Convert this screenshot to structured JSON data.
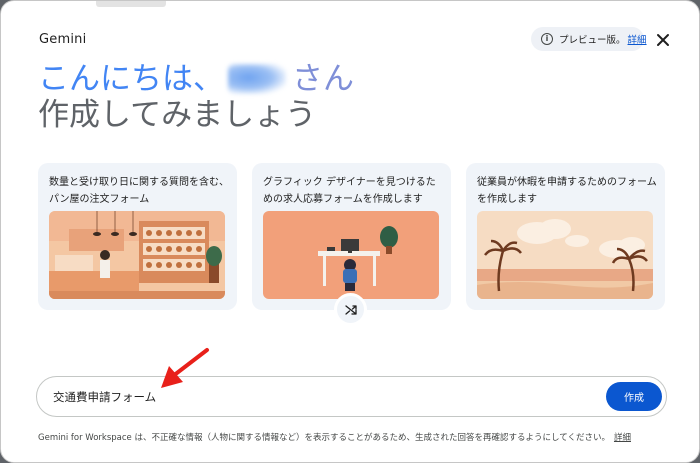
{
  "app": {
    "title": "Gemini"
  },
  "preview": {
    "text": "プレビュー版。",
    "link": "詳細"
  },
  "greeting": {
    "hello": "こんにちは、",
    "name_suffix": "さん",
    "subheading": "作成してみましょう"
  },
  "cards": [
    {
      "text": "数量と受け取り日に関する質問を含む、パン屋の注文フォーム",
      "illustration": "bakery"
    },
    {
      "text": "グラフィック デザイナーを見つけるための求人応募フォームを作成します",
      "illustration": "designer-desk"
    },
    {
      "text": "従業員が休暇を申請するためのフォームを作成します",
      "illustration": "beach"
    }
  ],
  "prompt": {
    "value": "交通費申請フォーム",
    "submit_label": "作成"
  },
  "footer": {
    "disclaimer": "Gemini for Workspace は、不正確な情報（人物に関する情報など）を表示することがあるため、生成された回答を再確認するようにしてください。",
    "link": "詳細"
  },
  "icons": {
    "info": "info-icon",
    "close": "close-icon",
    "shuffle": "shuffle-icon",
    "annotation": "red-arrow"
  },
  "colors": {
    "accent": "#0b57d0",
    "greeting_blue": "#4285f4",
    "card_bg": "#f0f4f9",
    "arrow": "#e8201a"
  }
}
